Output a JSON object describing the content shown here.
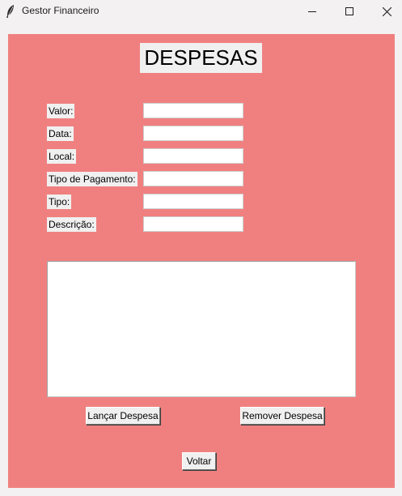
{
  "window": {
    "title": "Gestor Financeiro",
    "icon": "feather-icon",
    "controls": [
      "minimize-icon",
      "maximize-icon",
      "close-icon"
    ]
  },
  "colors": {
    "panel_background": "#f08080",
    "widget_background": "#f0f0f0"
  },
  "form": {
    "heading": "DESPESAS",
    "fields": [
      {
        "label": "Valor:",
        "value": ""
      },
      {
        "label": "Data:",
        "value": ""
      },
      {
        "label": "Local:",
        "value": ""
      },
      {
        "label": "Tipo de Pagamento:",
        "value": ""
      },
      {
        "label": "Tipo:",
        "value": ""
      },
      {
        "label": "Descrição:",
        "value": ""
      }
    ],
    "list_content": ""
  },
  "buttons": {
    "add": "Lançar Despesa",
    "remove": "Remover Despesa",
    "back": "Voltar"
  }
}
